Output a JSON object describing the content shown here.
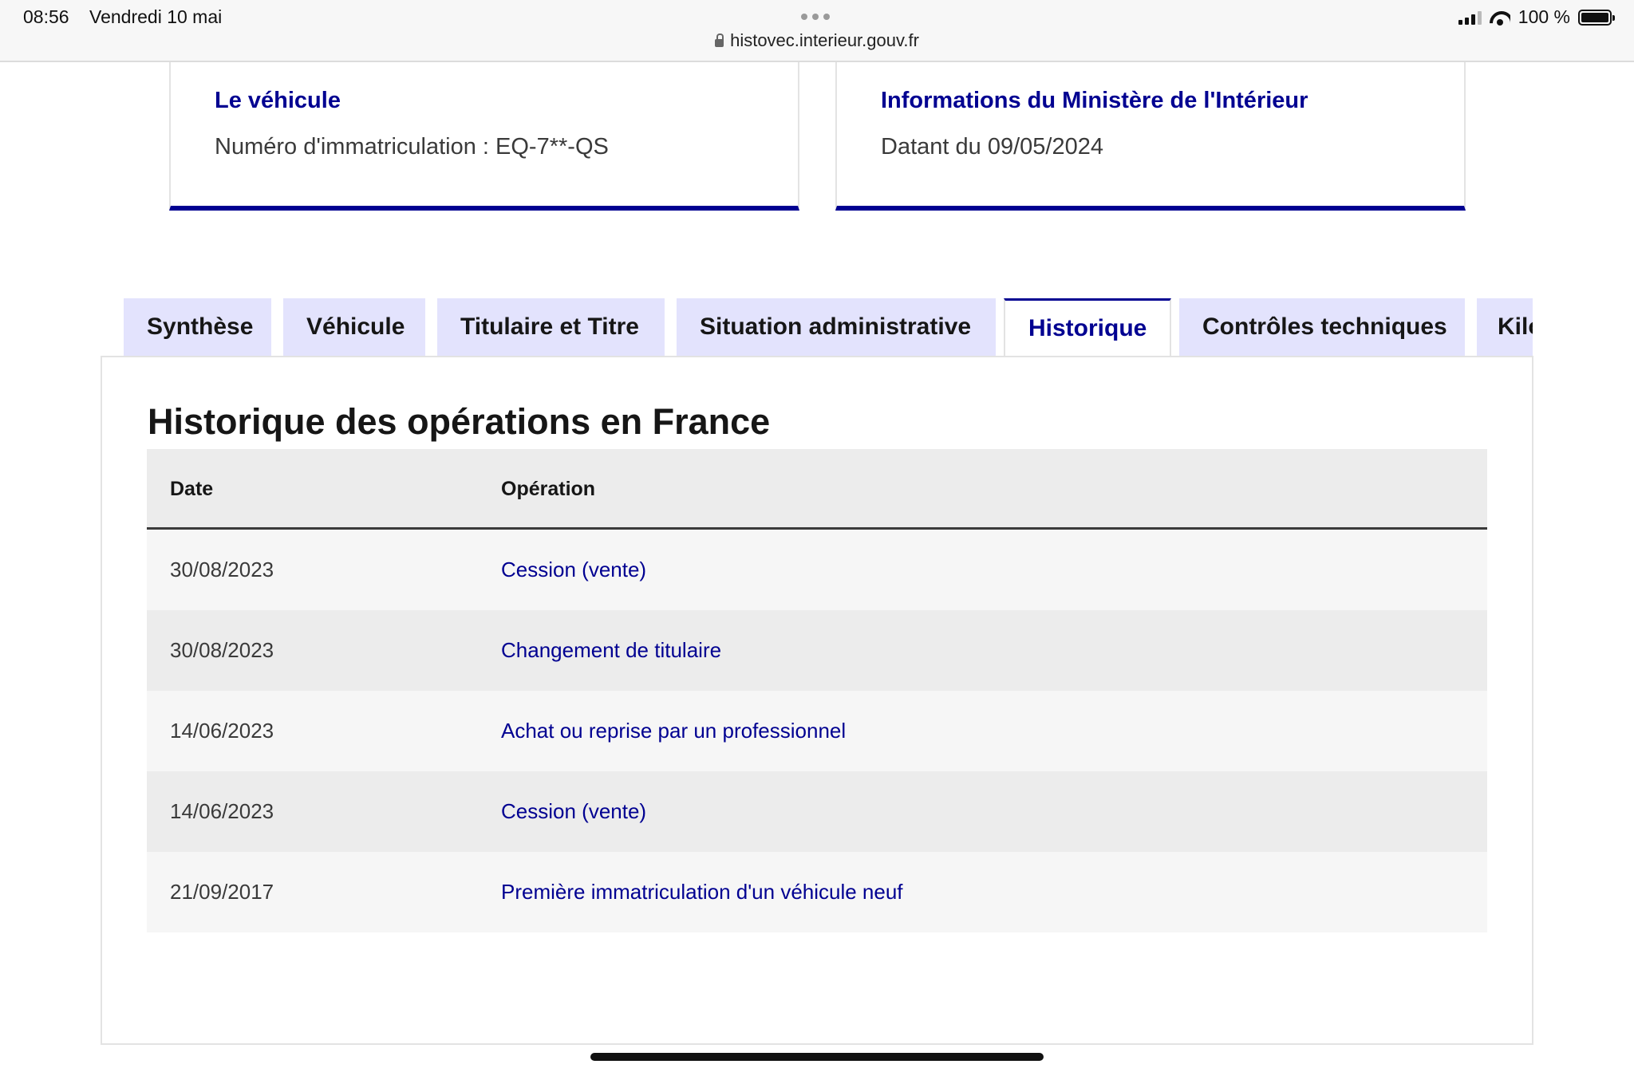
{
  "status_bar": {
    "time": "08:56",
    "date": "Vendredi 10 mai",
    "url": "histovec.interieur.gouv.fr",
    "battery": "100 %"
  },
  "cards": {
    "vehicle": {
      "title": "Le véhicule",
      "text": "Numéro d'immatriculation : EQ-7**-QS"
    },
    "ministry": {
      "title": "Informations du Ministère de l'Intérieur",
      "text": "Datant du 09/05/2024"
    }
  },
  "tabs": [
    {
      "label": "Synthèse"
    },
    {
      "label": "Véhicule"
    },
    {
      "label": "Titulaire et Titre"
    },
    {
      "label": "Situation administrative"
    },
    {
      "label": "Historique",
      "active": true
    },
    {
      "label": "Contrôles techniques"
    },
    {
      "label": "Kilométrage"
    }
  ],
  "history": {
    "title": "Historique des opérations en France",
    "columns": {
      "date": "Date",
      "operation": "Opération"
    },
    "rows": [
      {
        "date": "30/08/2023",
        "operation": "Cession (vente)"
      },
      {
        "date": "30/08/2023",
        "operation": "Changement de titulaire"
      },
      {
        "date": "14/06/2023",
        "operation": "Achat ou reprise par un professionnel"
      },
      {
        "date": "14/06/2023",
        "operation": "Cession (vente)"
      },
      {
        "date": "21/09/2017",
        "operation": "Première immatriculation d'un véhicule neuf"
      }
    ]
  },
  "colors": {
    "accent": "#000091",
    "tab_background": "#e3e3fd"
  }
}
